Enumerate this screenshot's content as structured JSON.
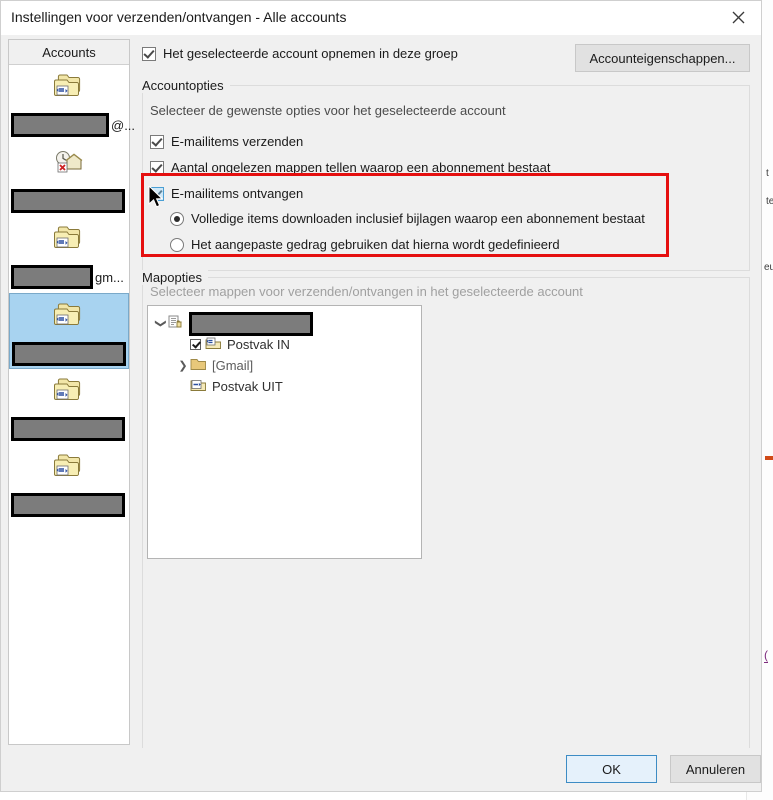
{
  "dialog": {
    "title": "Instellingen voor verzenden/ontvangen - Alle accounts",
    "close_icon": "close-icon"
  },
  "sidebar": {
    "header": "Accounts",
    "items": [
      {
        "icon": "account-folder-sync-icon",
        "redacted": true,
        "redact_width": 92,
        "suffix": "@...",
        "selected": false
      },
      {
        "icon": "account-offline-error-icon",
        "redacted": true,
        "redact_width": 108,
        "suffix": "",
        "selected": false
      },
      {
        "icon": "account-folder-sync-icon",
        "redacted": true,
        "redact_width": 76,
        "suffix": "gm...",
        "selected": false
      },
      {
        "icon": "account-folder-sync-icon",
        "redacted": true,
        "redact_width": 108,
        "suffix": "",
        "selected": true
      },
      {
        "icon": "account-folder-sync-icon",
        "redacted": true,
        "redact_width": 108,
        "suffix": "",
        "selected": false
      },
      {
        "icon": "account-folder-sync-icon",
        "redacted": true,
        "redact_width": 108,
        "suffix": "",
        "selected": false
      }
    ]
  },
  "main": {
    "include_account": {
      "label": "Het geselecteerde account opnemen in deze groep",
      "checked": true
    },
    "account_properties_button": "Accounteigenschappen...",
    "account_options": {
      "title": "Accountopties",
      "description": "Selecteer de gewenste opties voor het geselecteerde account",
      "checkboxes": [
        {
          "label": "E-mailitems verzenden",
          "checked": true,
          "hover": false
        },
        {
          "label": "Aantal ongelezen mappen tellen waarop een abonnement bestaat",
          "checked": true,
          "hover": false
        },
        {
          "label": "E-mailitems ontvangen",
          "checked": true,
          "hover": true
        }
      ],
      "radios": [
        {
          "label": "Volledige items downloaden inclusief bijlagen waarop een abonnement bestaat",
          "selected": true
        },
        {
          "label": "Het aangepaste gedrag gebruiken dat hierna wordt gedefinieerd",
          "selected": false
        }
      ]
    },
    "folder_options": {
      "title": "Mapopties",
      "description": "Selecteer mappen voor verzenden/ontvangen in het geselecteerde account",
      "description_disabled": true,
      "tree": [
        {
          "indent": 0,
          "chevron": "chevron-down-icon",
          "icon": "account-root-icon",
          "redacted": true,
          "redact_width": 118,
          "label": "",
          "checkbox": false,
          "checked": false
        },
        {
          "indent": 1,
          "chevron": "",
          "icon": "inbox-folder-icon",
          "redacted": false,
          "label": "Postvak IN",
          "checkbox": true,
          "checked": true
        },
        {
          "indent": 1,
          "chevron": "chevron-right-icon",
          "icon": "folder-icon",
          "redacted": false,
          "label": "[Gmail]",
          "checkbox": false,
          "checked": false,
          "dim": true
        },
        {
          "indent": 1,
          "chevron": "",
          "icon": "outbox-folder-icon",
          "redacted": false,
          "label": "Postvak UIT",
          "checkbox": false,
          "checked": false
        }
      ]
    }
  },
  "footer": {
    "ok": "OK",
    "cancel": "Annuleren"
  },
  "highlight": {
    "color": "#e50f0f",
    "target": "E-mailitems ontvangen"
  },
  "cursor": {
    "icon": "mouse-pointer-icon"
  }
}
